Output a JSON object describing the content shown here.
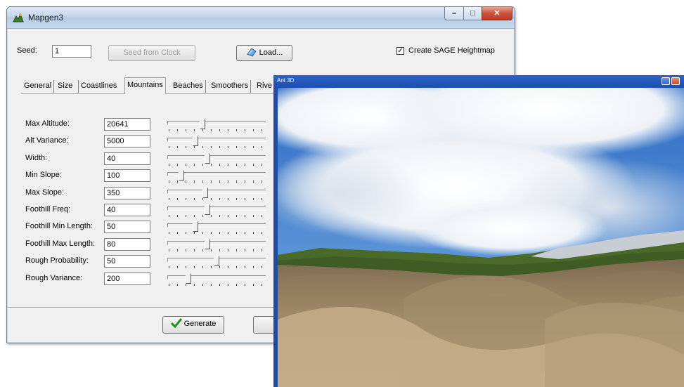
{
  "window": {
    "title": "Mapgen3",
    "controls": {
      "minimize": "–",
      "maximize": "□",
      "close": "✕"
    }
  },
  "seed": {
    "label": "Seed:",
    "value": "1",
    "from_clock_label": "Seed from Clock",
    "load_label": "Load...",
    "create_sage_label": "Create SAGE Heightmap",
    "create_sage_checked": true
  },
  "tabs": [
    {
      "label": "General",
      "active": false
    },
    {
      "label": "Size",
      "active": false
    },
    {
      "label": "Coastlines",
      "active": false
    },
    {
      "label": "Mountains",
      "active": true
    },
    {
      "label": "Beaches",
      "active": false
    },
    {
      "label": "Smoothers",
      "active": false
    },
    {
      "label": "Rive",
      "active": false
    }
  ],
  "params": [
    {
      "label": "Max Altitude:",
      "value": "20641",
      "slider_pos": 0.35
    },
    {
      "label": "Alt Variance:",
      "value": "5000",
      "slider_pos": 0.27
    },
    {
      "label": "Width:",
      "value": "40",
      "slider_pos": 0.4
    },
    {
      "label": "Min Slope:",
      "value": "100",
      "slider_pos": 0.12
    },
    {
      "label": "Max Slope:",
      "value": "350",
      "slider_pos": 0.38
    },
    {
      "label": "Foothill Freq:",
      "value": "40",
      "slider_pos": 0.4
    },
    {
      "label": "Foothill Min Length:",
      "value": "50",
      "slider_pos": 0.27
    },
    {
      "label": "Foothill Max Length:",
      "value": "80",
      "slider_pos": 0.4
    },
    {
      "label": "Rough Probability:",
      "value": "50",
      "slider_pos": 0.5
    },
    {
      "label": "Rough Variance:",
      "value": "200",
      "slider_pos": 0.2
    }
  ],
  "generate_label": "Generate",
  "preview_window": {
    "title": "Ant 3D"
  },
  "colors": {
    "accent_check": "#1f8f1f",
    "titlebar_3d": "#1a4fb0"
  }
}
